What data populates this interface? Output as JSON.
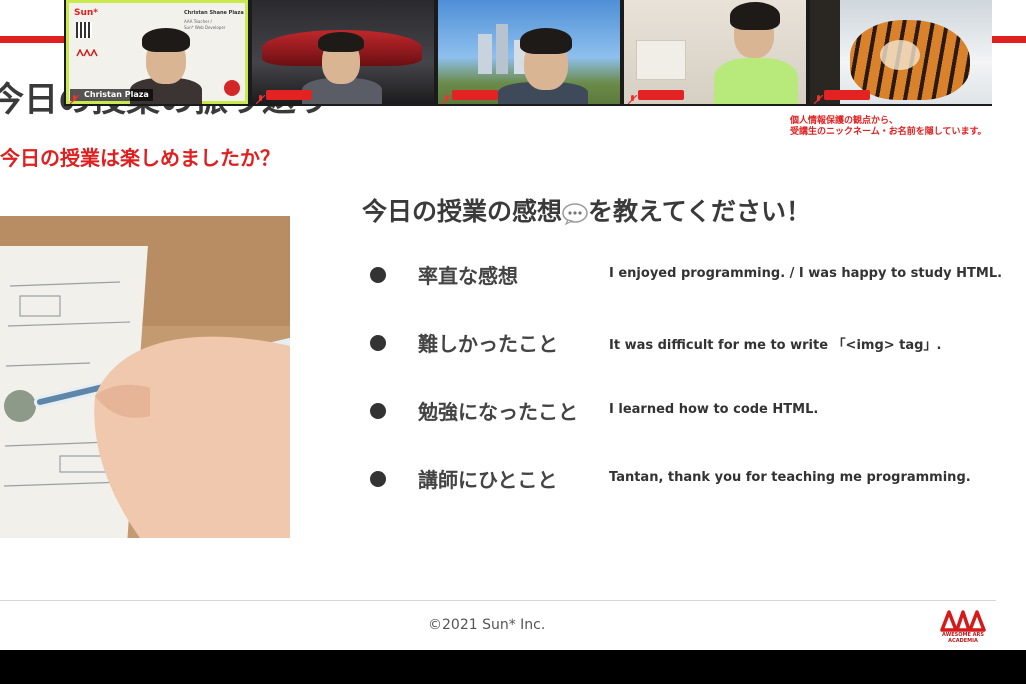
{
  "slide": {
    "title": "今日の授業の振り返り",
    "subtitle": "今日の授業は楽しめましたか？",
    "privacy_note_line1": "個人情報保護の観点から、",
    "privacy_note_line2": "受講生のニックネーム・お名前を隠しています。",
    "question_part1": "今日の授業の感想",
    "question_part2": "を教えてください！",
    "items": [
      {
        "label": "率直な感想",
        "answer": "I enjoyed programming. / I was happy to study HTML."
      },
      {
        "label": "難しかったこと",
        "answer": "It was difficult for me to write 「<img> tag」."
      },
      {
        "label": "勉強になったこと",
        "answer": "I learned how to code HTML."
      },
      {
        "label": "講師にひとこと",
        "answer": "Tantan, thank you for teaching me programming."
      }
    ],
    "copyright": "©2021 Sun* Inc.",
    "logo_caption_1": "AWESOME ARS",
    "logo_caption_2": "ACADEMIA"
  },
  "video_strip": {
    "tiles": [
      {
        "name": "Christan Plaza",
        "slide_brand": "Sun*",
        "slide_name": "Christan Shane Plaza",
        "slide_role_1": "AAA Teacher /",
        "slide_role_2": "Sun* Web Developer"
      },
      {
        "name": ""
      },
      {
        "name": ""
      },
      {
        "name": ""
      },
      {
        "name": ""
      }
    ]
  },
  "colors": {
    "accent_red": "#e02020",
    "active_speaker": "#c9e94f",
    "text_dark": "#3a3a3a"
  },
  "icons": {
    "bubble": "speech-bubble-icon",
    "mic": "microphone-muted-icon",
    "logo": "aaa-logo-icon"
  }
}
